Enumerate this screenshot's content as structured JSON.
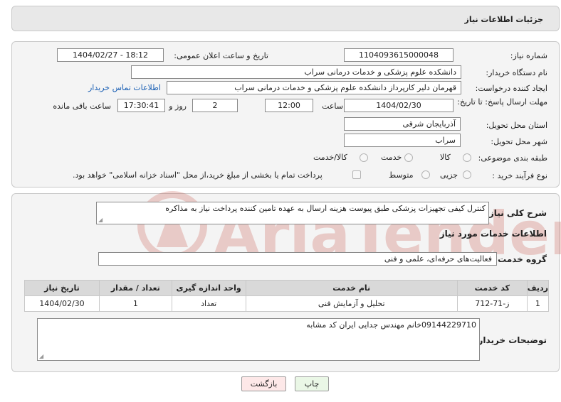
{
  "header": {
    "title": "جزئیات اطلاعات نیاز"
  },
  "fields": {
    "need_number_label": "شماره نیاز:",
    "need_number_value": "1104093615000048",
    "announce_label": "تاریخ و ساعت اعلان عمومی:",
    "announce_value": "1404/02/27 - 18:12",
    "buyer_org_label": "نام دستگاه خریدار:",
    "buyer_org_value": "دانشکده علوم پزشکی و خدمات درمانی سراب",
    "requester_label": "ایجاد کننده درخواست:",
    "requester_value": "قهرمان دلیر کارپرداز دانشکده علوم پزشکی و خدمات درمانی سراب",
    "contact_link": "اطلاعات تماس خریدار",
    "deadline_label": "مهلت ارسال پاسخ: تا تاریخ:",
    "deadline_date": "1404/02/30",
    "time_label": "ساعت",
    "deadline_time": "12:00",
    "days_value": "2",
    "days_label": "روز و",
    "remaining_time": "17:30:41",
    "remaining_label": "ساعت باقی مانده",
    "province_label": "استان محل تحویل:",
    "province_value": "آذربایجان شرقی",
    "city_label": "شهر محل تحویل:",
    "city_value": "سراب",
    "category_label": "طبقه بندی موضوعی:",
    "category_options": [
      "کالا",
      "خدمت",
      "کالا/خدمت"
    ],
    "process_label": "نوع فرآیند خرید :",
    "process_options": [
      "جزیی",
      "متوسط"
    ],
    "payment_note": "پرداخت تمام یا بخشی از مبلغ خرید،از محل \"اسناد خزانه اسلامی\" خواهد بود."
  },
  "summary": {
    "label": "شرح کلی نیاز:",
    "value": "کنترل کیفی تجهیزات پزشکی طبق پیوست هزینه ارسال به عهده تامین کننده پرداخت نیاز به مذاکره"
  },
  "services": {
    "section_title": "اطلاعات خدمات مورد نیاز",
    "group_label": "گروه خدمت:",
    "group_value": "فعالیت‌های حرفه‌ای، علمی و فنی",
    "columns": [
      "ردیف",
      "کد خدمت",
      "نام خدمت",
      "واحد اندازه گیری",
      "تعداد / مقدار",
      "تاریخ نیاز"
    ],
    "rows": [
      [
        "1",
        "ز-71-712",
        "تحلیل و آزمایش فنی",
        "تعداد",
        "1",
        "1404/02/30"
      ]
    ]
  },
  "buyer_notes": {
    "label": "توضیحات خریدار:",
    "value": "09144229710خانم مهندس جدایی ایران کد مشابه"
  },
  "buttons": {
    "print": "چاپ",
    "back": "بازگشت"
  },
  "watermark_text": "AriaTender.neT",
  "colors": {
    "link": "#1a5fb4",
    "back_button": "#fde8e8",
    "print_button": "#eaf7e6"
  }
}
